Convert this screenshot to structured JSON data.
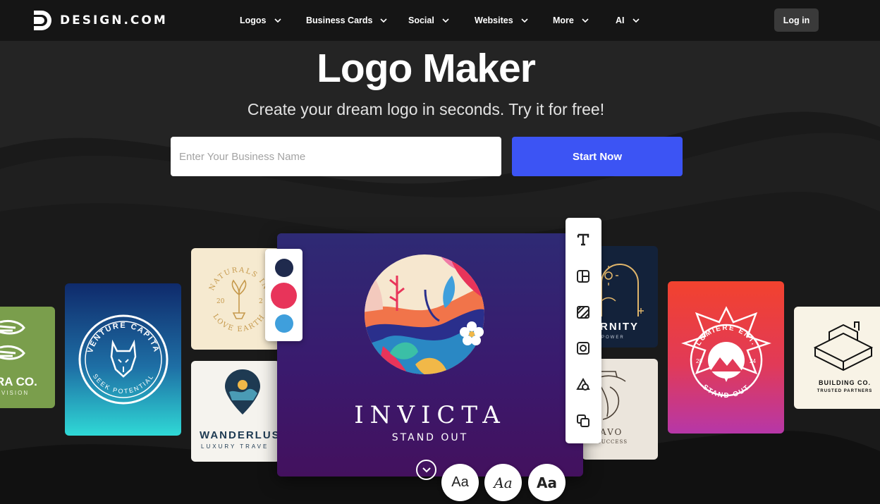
{
  "nav": {
    "brand": "DESIGN.COM",
    "items": [
      {
        "label": "Logos"
      },
      {
        "label": "Business Cards"
      },
      {
        "label": "Social"
      },
      {
        "label": "Websites"
      },
      {
        "label": "More"
      },
      {
        "label": "AI"
      }
    ],
    "login": "Log in"
  },
  "hero": {
    "title": "Logo Maker",
    "subtitle": "Create your dream logo in seconds. Try it for free!",
    "input_placeholder": "Enter Your Business Name",
    "cta": "Start Now"
  },
  "cards": {
    "terra": {
      "name": "RA CO.",
      "tagline": "VISION"
    },
    "venture": {
      "arc_top": "VENTURE CAPITA",
      "arc_bottom": "SEEK POTENTIAL"
    },
    "naturals": {
      "arc_top": "NATURALS IN",
      "arc_bottom": "LOVE EARTH",
      "left_num": "20",
      "right_num": "2"
    },
    "wanderlust": {
      "name": "WANDERLUS",
      "tagline": "LUXURY TRAVE"
    },
    "eternity": {
      "name": "RNITY",
      "tagline": "POWER"
    },
    "bravo": {
      "name": "AVO",
      "tagline": "SUCCESS"
    },
    "lumiere": {
      "arc_top": "LUMIERE ENT.",
      "arc_bottom": "STAND OUT",
      "left_num": "20",
      "right_num": "24"
    },
    "building": {
      "name": "BUILDING CO.",
      "tagline": "TRUSTED PARTNERS"
    },
    "main": {
      "name": "INVICTA",
      "tagline": "STAND OUT"
    }
  },
  "palette": {
    "colors": [
      "#1f2a4d",
      "#e8345a",
      "#3f9fdc"
    ]
  },
  "font_buttons": [
    "Aa",
    "Aa",
    "Aa"
  ],
  "colors": {
    "accent": "#3c54f4",
    "nav_bg": "#151515",
    "page_bg": "#1b1b1b"
  }
}
